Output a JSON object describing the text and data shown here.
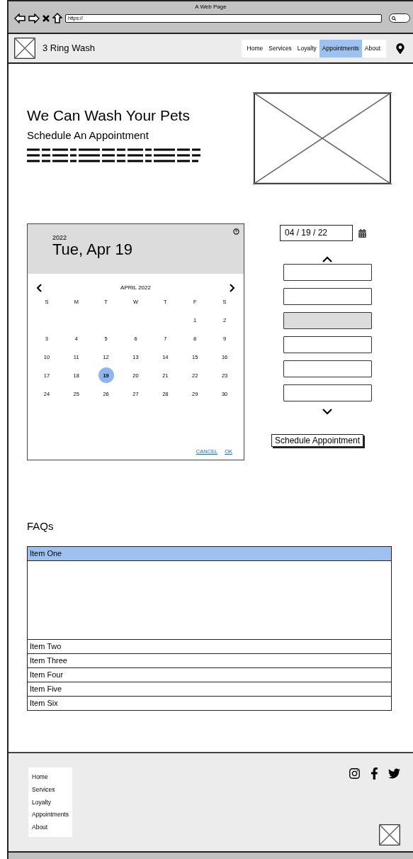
{
  "browser": {
    "title": "A Web Page",
    "url": "https://"
  },
  "nav": {
    "brand": "3 Ring Wash",
    "links": [
      {
        "label": "Home",
        "selected": false
      },
      {
        "label": "Services",
        "selected": false
      },
      {
        "label": "Loyalty",
        "selected": false
      },
      {
        "label": "Appointments",
        "selected": true
      },
      {
        "label": "About",
        "selected": false
      }
    ]
  },
  "hero": {
    "title": "We Can Wash Your Pets",
    "subtitle": "Schedule An Appointment"
  },
  "date_picker": {
    "year": "2022",
    "date": "Tue, Apr 19",
    "month": "APRIL 2022",
    "weekdays": [
      "S",
      "M",
      "T",
      "W",
      "T",
      "F",
      "S"
    ],
    "weeks": [
      {
        "days": [
          {
            "label": "1",
            "selected": false
          },
          {
            "label": "2",
            "selected": false
          }
        ]
      },
      {
        "days": [
          {
            "label": "3",
            "selected": false
          },
          {
            "label": "4",
            "selected": false
          },
          {
            "label": "5",
            "selected": false
          },
          {
            "label": "6",
            "selected": false
          },
          {
            "label": "7",
            "selected": false
          },
          {
            "label": "8",
            "selected": false
          },
          {
            "label": "9",
            "selected": false
          }
        ]
      },
      {
        "days": [
          {
            "label": "10",
            "selected": false
          },
          {
            "label": "11",
            "selected": false
          },
          {
            "label": "12",
            "selected": false
          },
          {
            "label": "13",
            "selected": false
          },
          {
            "label": "14",
            "selected": false
          },
          {
            "label": "15",
            "selected": false
          },
          {
            "label": "16",
            "selected": false
          }
        ]
      },
      {
        "days": [
          {
            "label": "17",
            "selected": false
          },
          {
            "label": "18",
            "selected": false
          },
          {
            "label": "19",
            "selected": true
          },
          {
            "label": "20",
            "selected": false
          },
          {
            "label": "21",
            "selected": false
          },
          {
            "label": "22",
            "selected": false
          },
          {
            "label": "23",
            "selected": false
          }
        ]
      },
      {
        "days": [
          {
            "label": "24",
            "selected": false
          },
          {
            "label": "25",
            "selected": false
          },
          {
            "label": "26",
            "selected": false
          },
          {
            "label": "27",
            "selected": false
          },
          {
            "label": "28",
            "selected": false
          },
          {
            "label": "29",
            "selected": false
          },
          {
            "label": "30",
            "selected": false
          }
        ]
      }
    ],
    "actions": [
      "CANCEL",
      "OK"
    ]
  },
  "date_field": {
    "value": "04 / 19 / 22"
  },
  "time_slots": [
    {
      "selected": false
    },
    {
      "selected": false
    },
    {
      "selected": true
    },
    {
      "selected": false
    },
    {
      "selected": false
    },
    {
      "selected": false
    }
  ],
  "schedule_button": "Schedule Appointment",
  "faqs": {
    "title": "FAQs",
    "items": [
      {
        "label": "Item One",
        "expanded": true
      },
      {
        "label": "Item Two",
        "expanded": false
      },
      {
        "label": "Item Three",
        "expanded": false
      },
      {
        "label": "Item Four",
        "expanded": false
      },
      {
        "label": "Item Five",
        "expanded": false
      },
      {
        "label": "Item Six",
        "expanded": false
      }
    ]
  },
  "footer": {
    "links": [
      "Home",
      "Services",
      "Loyalty",
      "Appointments",
      "About"
    ]
  }
}
